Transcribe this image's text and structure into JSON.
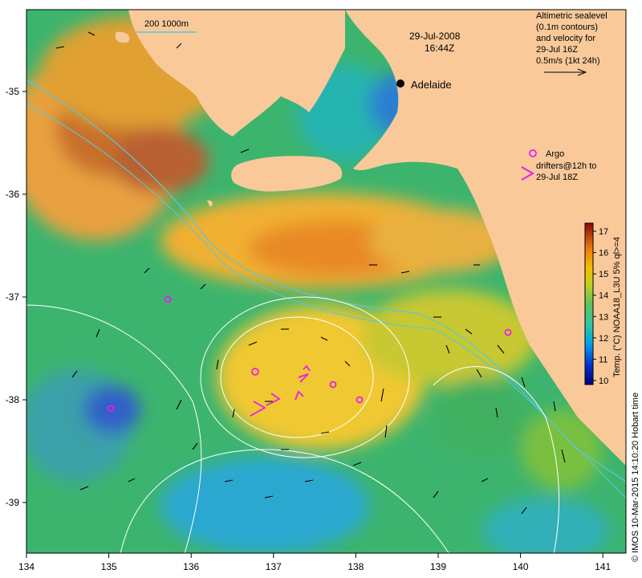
{
  "map": {
    "date": "29-Jul-2008",
    "time": "16:44Z",
    "place_label": "Adelaide",
    "scale_label": "200  1000m",
    "legend_lines": [
      "Altimetric sealevel",
      "(0.1m contours)",
      "and velocity for",
      "29-Jul 16Z",
      "0.5m/s (1kt 24h)"
    ],
    "argo_lines": [
      "Argo",
      "drifters@12h to",
      "29-Jul 18Z"
    ],
    "colorbar_title": "Temp. (°C) NOAA18_L3U 5% ql>=4",
    "colorbar_ticks": [
      "10",
      "11",
      "12",
      "13",
      "14",
      "15",
      "16",
      "17"
    ],
    "credit": "© IMOS 10-Mar-2015 14:10:20 Hobart time",
    "x_ticks": [
      "134",
      "135",
      "136",
      "137",
      "138",
      "139",
      "140",
      "141"
    ],
    "y_ticks": [
      "-35",
      "-36",
      "-37",
      "-38",
      "-39"
    ],
    "colors": {
      "land": "#f9c99a",
      "argo": "#e81ee8",
      "contour": "#ffffff",
      "isobath": "#55c8e0"
    }
  }
}
